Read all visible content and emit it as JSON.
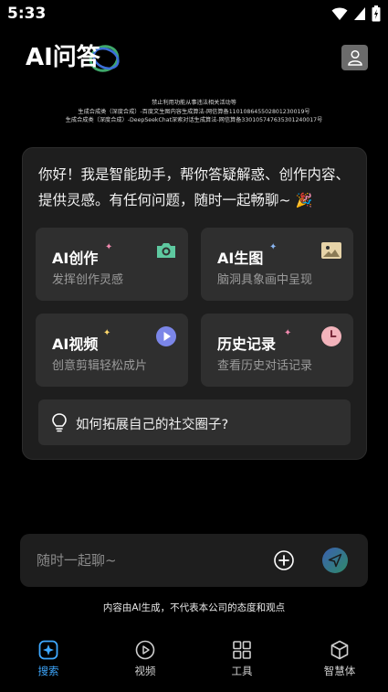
{
  "status_bar": {
    "time": "5:33"
  },
  "header": {
    "logo_text": "AI问答",
    "disclaimer": [
      "禁止利用功能从事违法相关活动等",
      "生成合成类（深度合成）-百度文生图内容生成算法-网信算备110108645502801230019号",
      "生成合成类（深度合成）-DeepSeekChat深索对话生成算法-网信算备330105747635301240017号"
    ]
  },
  "greeting": {
    "text": "你好！我是智能助手，帮你答疑解惑、创作内容、提供灵感。有任何问题，随时一起畅聊~",
    "emoji": "🎉"
  },
  "features": [
    {
      "title": "AI创作",
      "subtitle": "发挥创作灵感",
      "icon": "camera-icon",
      "sparkle": "✦",
      "color": "#5ec9a0"
    },
    {
      "title": "AI生图",
      "subtitle": "脑洞具象画中呈现",
      "icon": "image-icon",
      "sparkle": "✦",
      "color": "#e6d3a8"
    },
    {
      "title": "AI视频",
      "subtitle": "创意剪辑轻松成片",
      "icon": "play-icon",
      "sparkle": "✦",
      "color": "#7b86e8"
    },
    {
      "title": "历史记录",
      "subtitle": "查看历史对话记录",
      "icon": "clock-icon",
      "sparkle": "✦",
      "color": "#f2b3bb"
    }
  ],
  "suggestion": {
    "text": "如何拓展自己的社交圈子?",
    "icon": "lightbulb-icon"
  },
  "input": {
    "placeholder": "随时一起聊~"
  },
  "footer_note": "内容由AI生成，不代表本公司的态度和观点",
  "bottom_nav": [
    {
      "label": "搜索",
      "icon": "search-sparkle-icon",
      "active": true
    },
    {
      "label": "视频",
      "icon": "play-circle-icon",
      "active": false
    },
    {
      "label": "工具",
      "icon": "grid-icon",
      "active": false
    },
    {
      "label": "智慧体",
      "icon": "cube-icon",
      "active": false
    }
  ],
  "colors": {
    "accent": "#3ea8ff",
    "background": "#000000",
    "card": "#1e1e1e",
    "tile": "#2f2f2f"
  }
}
